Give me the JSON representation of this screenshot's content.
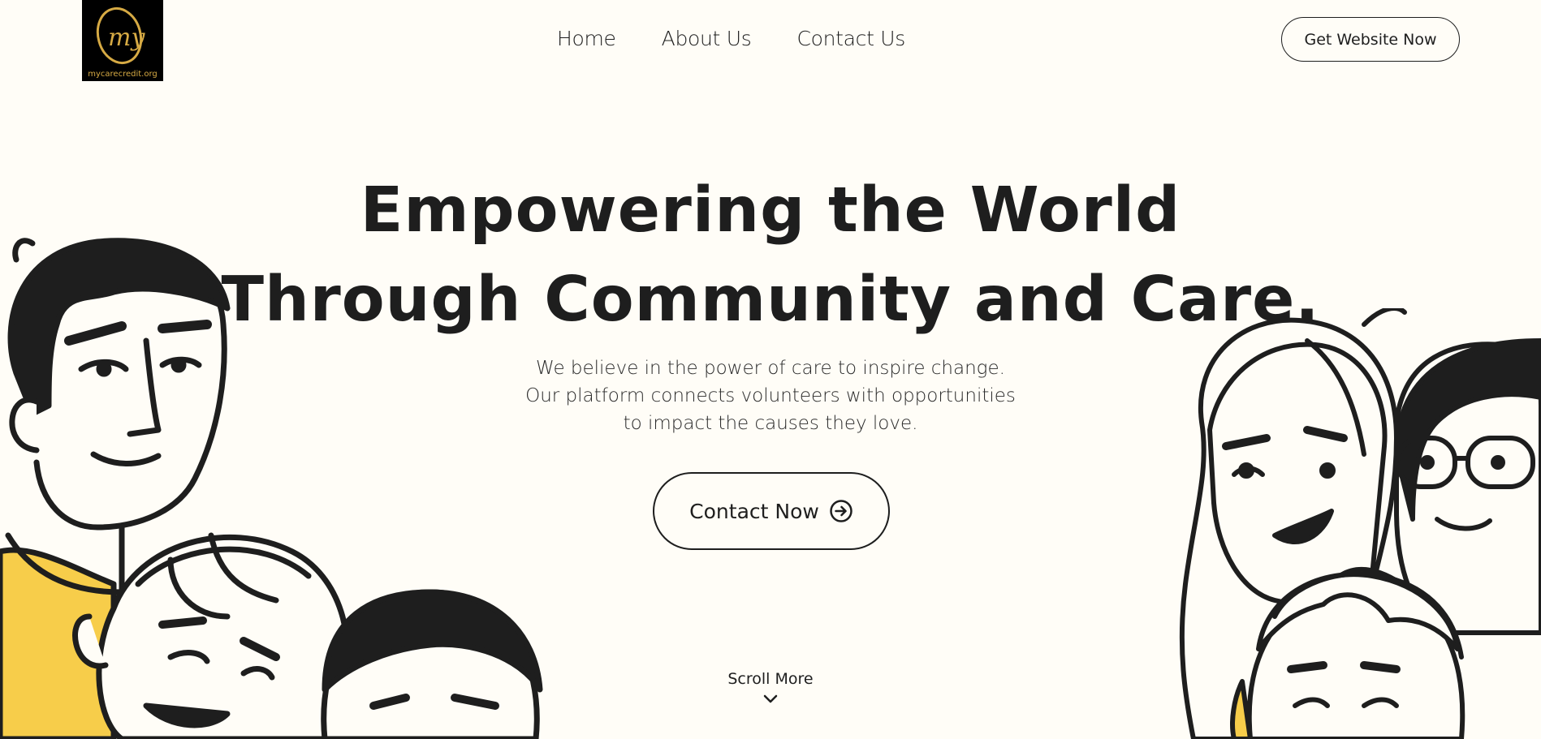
{
  "header": {
    "logo_text": "mycarecredit.org",
    "nav": [
      "Home",
      "About Us",
      "Contact Us"
    ],
    "cta_label": "Get Website Now"
  },
  "hero": {
    "title_line1": "Empowering the World",
    "title_line2_a": "Through ",
    "title_highlight1": "Community",
    "title_line2_b": " and ",
    "title_highlight2": "Care.",
    "subtitle": [
      "We believe in the power of care to inspire change.",
      "Our platform connects volunteers with opportunities",
      "to impact the causes they love."
    ],
    "cta_label": "Contact Now"
  },
  "scroll_label": "Scroll More",
  "colors": {
    "background": "#fffdf7",
    "accent": "#e7bf57",
    "ink": "#1e1e1e",
    "logo_gold": "#d6aa44"
  },
  "icons": [
    "arrow-circle-right-icon",
    "chevron-down-icon"
  ]
}
